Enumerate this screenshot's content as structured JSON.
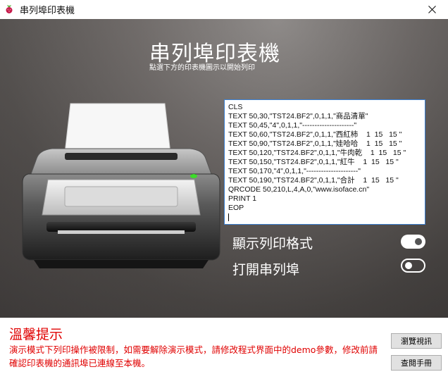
{
  "window": {
    "title": "串列埠印表機"
  },
  "header": {
    "title": "串列埠印表機",
    "subtitle": "點選下方的印表機圖示以開始列印"
  },
  "printer": {
    "icon": "printer-icon"
  },
  "code": {
    "lines": [
      "CLS",
      "TEXT 50,30,\"TST24.BF2\",0,1,1,\"商品清單\"",
      "TEXT 50,45,\"4\",0,1,1,\"---------------------\"",
      "TEXT 50,60,\"TST24.BF2\",0,1,1,\"西紅柿    1  15   15 \"",
      "TEXT 50,90,\"TST24.BF2\",0,1,1,\"娃哈哈    1  15   15 \"",
      "TEXT 50,120,\"TST24.BF2\",0,1,1,\"牛肉乾    1  15   15 \"",
      "TEXT 50,150,\"TST24.BF2\",0,1,1,\"紅牛    1  15   15 \"",
      "TEXT 50,170,\"4\",0,1,1,\"---------------------\"",
      "TEXT 50,190,\"TST24.BF2\",0,1,1,\"合計    1  15   15 \"",
      "QRCODE 50,210,L,4,A,0,\"www.isoface.cn\"",
      "PRINT 1",
      "EOP"
    ]
  },
  "options": {
    "show_format": {
      "label": "顯示列印格式",
      "state": "on"
    },
    "open_serial": {
      "label": "打開串列埠",
      "state": "off"
    }
  },
  "warning": {
    "title": "溫馨提示",
    "text": "演示模式下列印操作被限制，如需要解除演示模式，請修改程式界面中的demo參數，修改前請確認印表機的通訊埠已連線至本機。"
  },
  "buttons": {
    "browse": "瀏覽視訊",
    "manual": "查閱手冊"
  },
  "colors": {
    "warning": "#e00000",
    "code_border": "#3b7fd1",
    "led": "#3ddc2a"
  }
}
